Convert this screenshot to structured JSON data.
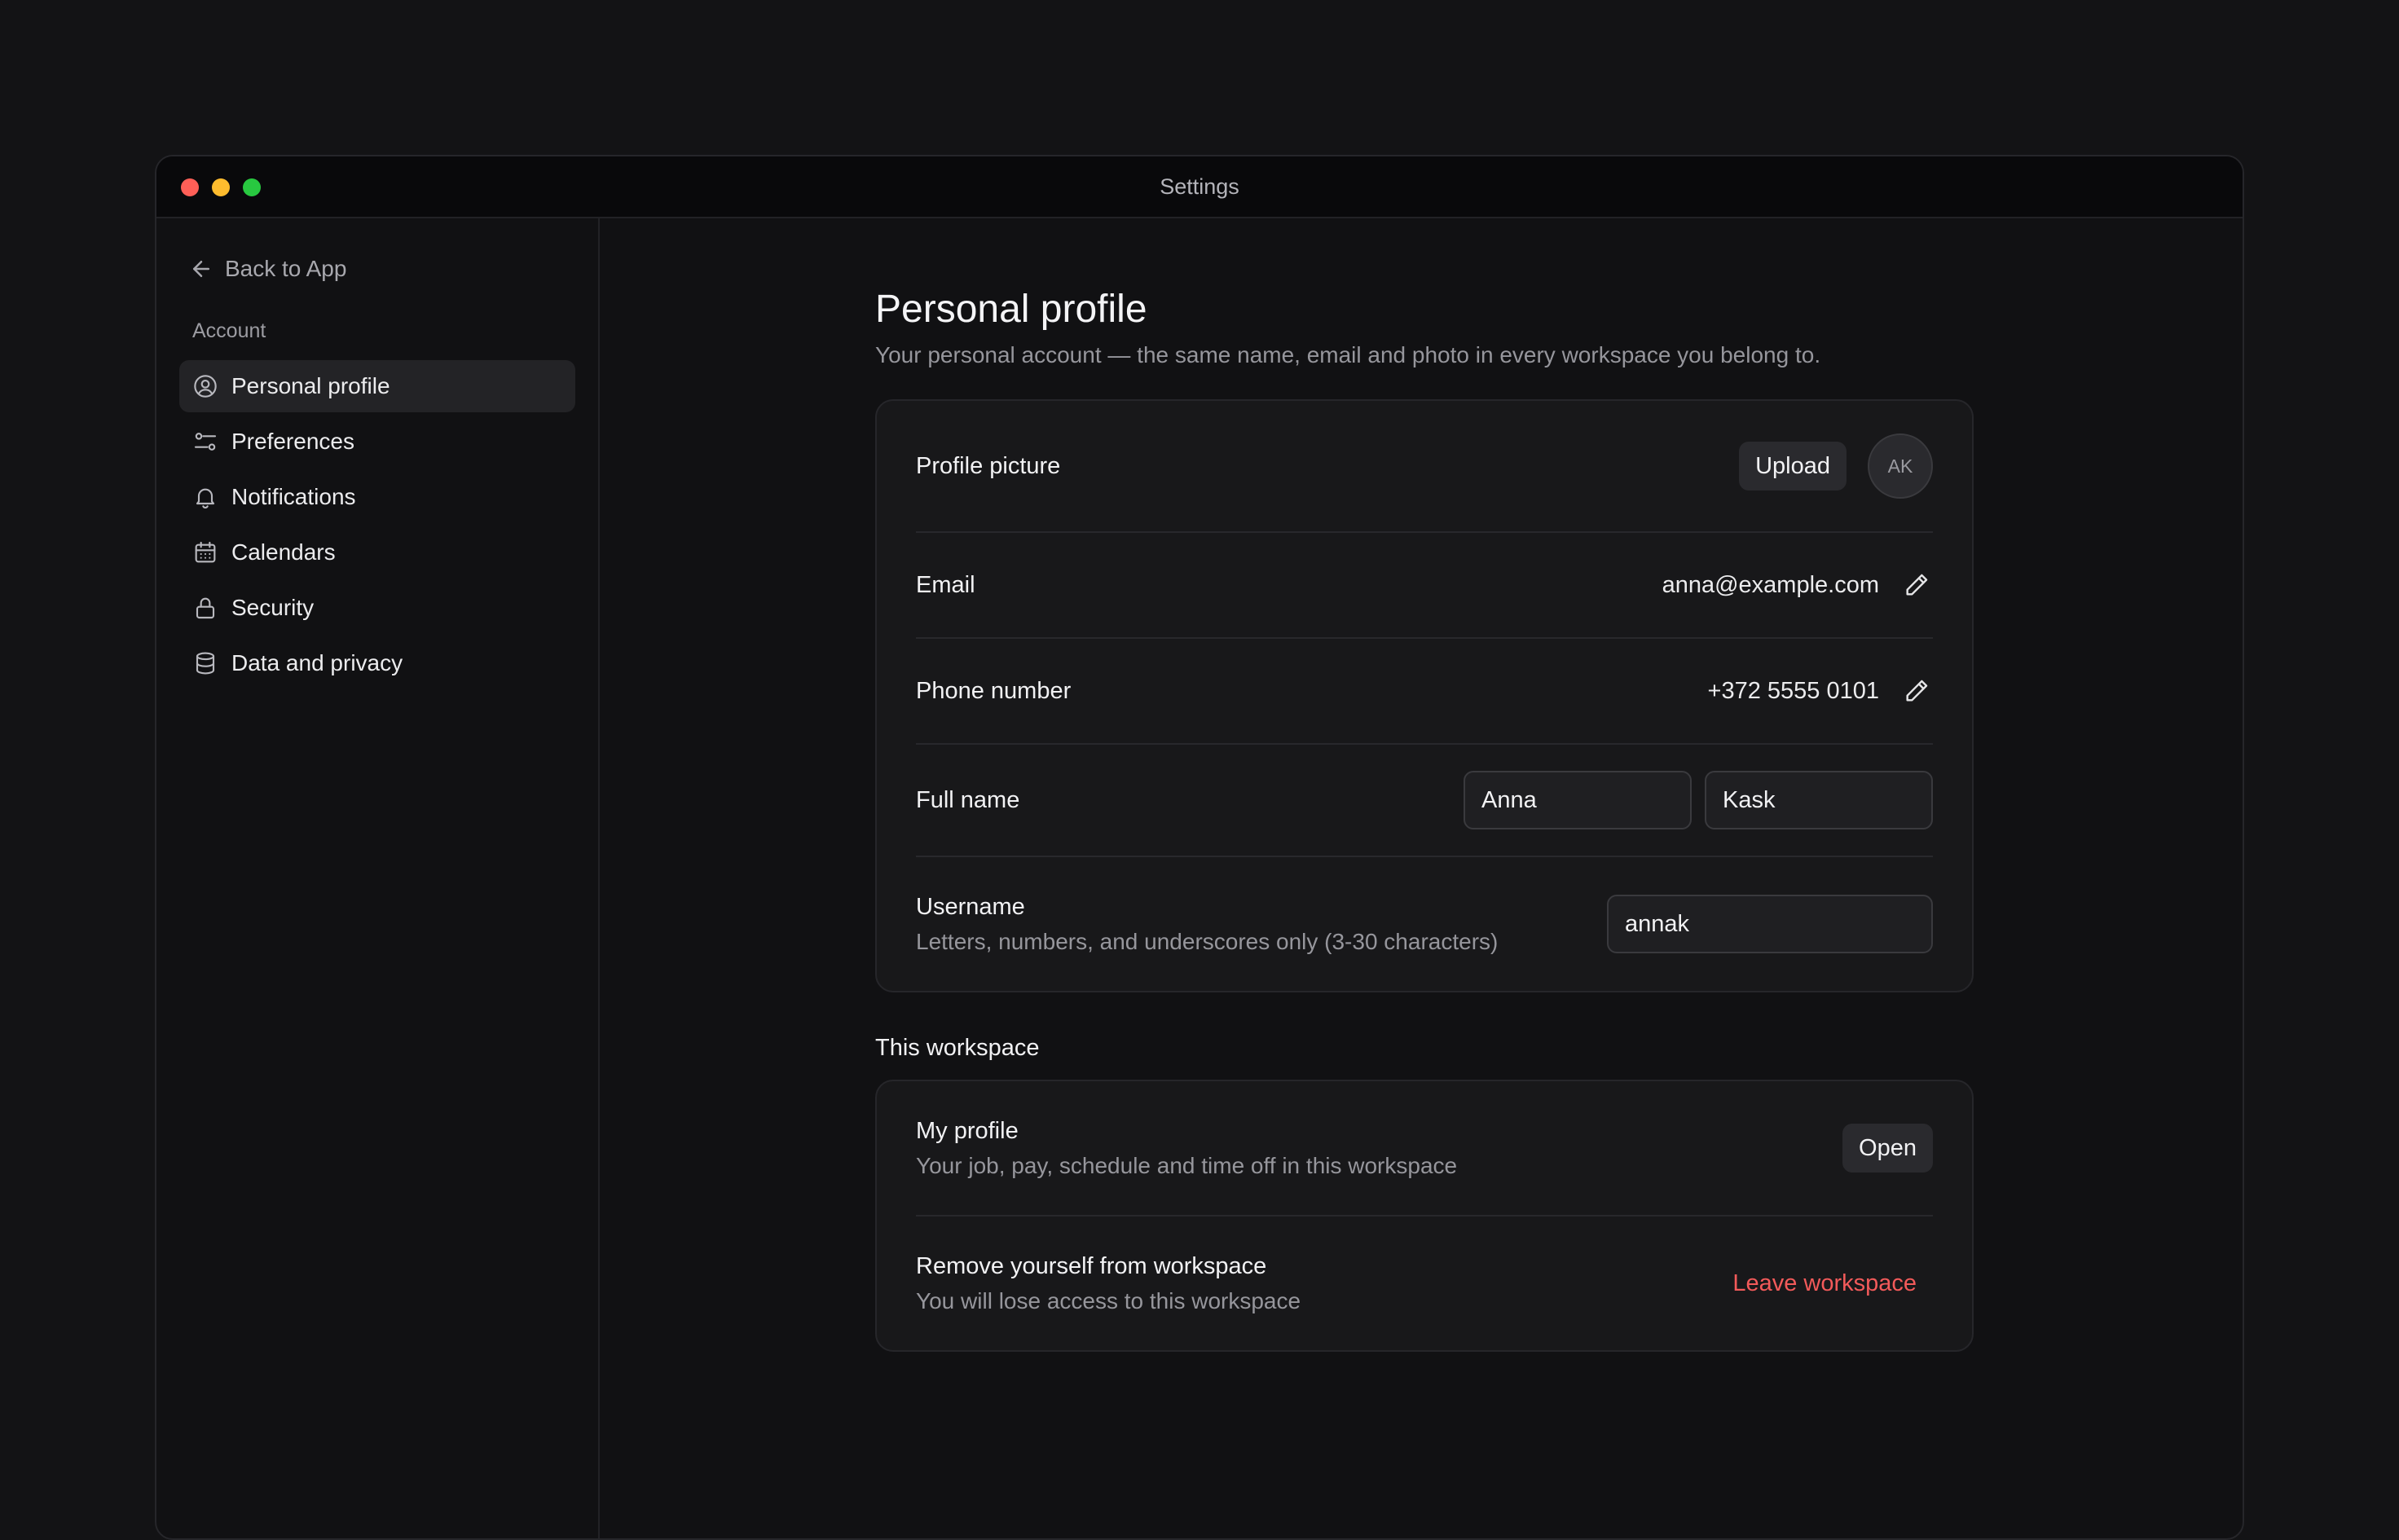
{
  "window": {
    "title": "Settings"
  },
  "sidebar": {
    "back_label": "Back to App",
    "section_label": "Account",
    "items": [
      {
        "label": "Personal profile",
        "icon": "user-circle-icon",
        "active": true
      },
      {
        "label": "Preferences",
        "icon": "sliders-icon"
      },
      {
        "label": "Notifications",
        "icon": "bell-icon"
      },
      {
        "label": "Calendars",
        "icon": "calendar-icon"
      },
      {
        "label": "Security",
        "icon": "lock-icon"
      },
      {
        "label": "Data and privacy",
        "icon": "database-icon"
      }
    ]
  },
  "main": {
    "title": "Personal profile",
    "subtitle": "Your personal account — the same name, email and photo in every workspace you belong to.",
    "profile": {
      "picture_label": "Profile picture",
      "upload_label": "Upload",
      "avatar_initials": "AK",
      "email_label": "Email",
      "email_value": "anna@example.com",
      "phone_label": "Phone number",
      "phone_value": "+372 5555 0101",
      "fullname_label": "Full name",
      "first_name": "Anna",
      "last_name": "Kask",
      "username_label": "Username",
      "username_hint": "Letters, numbers, and underscores only (3-30 characters)",
      "username_value": "annak"
    },
    "workspace": {
      "section_title": "This workspace",
      "my_profile_label": "My profile",
      "my_profile_desc": "Your job, pay, schedule and time off in this workspace",
      "open_label": "Open",
      "remove_label": "Remove yourself from workspace",
      "remove_desc": "You will lose access to this workspace",
      "leave_label": "Leave workspace"
    }
  },
  "colors": {
    "background": "#131315",
    "card": "#18181a",
    "danger": "#f25a5a",
    "active_nav": "#232326"
  }
}
